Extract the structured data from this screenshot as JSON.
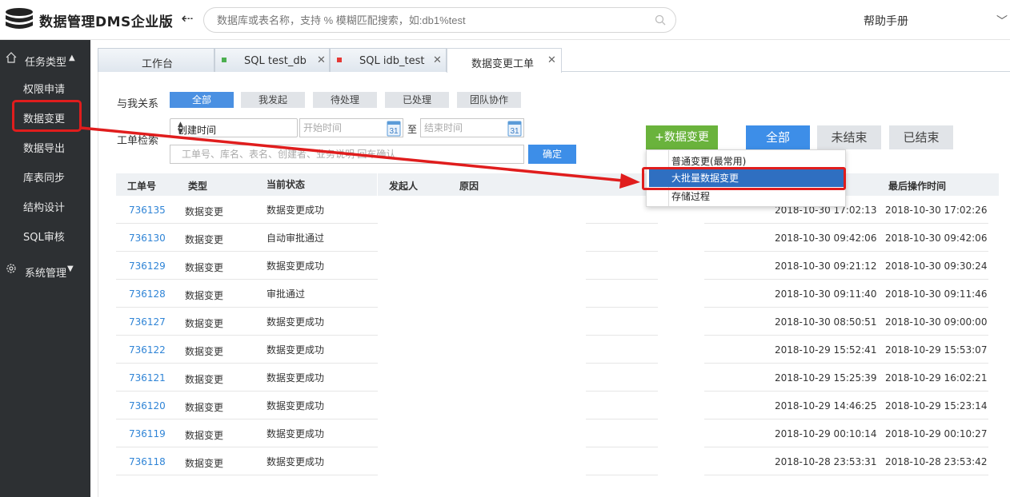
{
  "header": {
    "app_title": "数据管理DMS企业版",
    "search_placeholder": "数据库或表名称，支持 % 模糊匹配搜索，如:db1%test",
    "help": "帮助手册"
  },
  "sidebar": {
    "group_tasks": "任务类型",
    "items": [
      "权限申请",
      "数据变更",
      "数据导出",
      "库表同步",
      "结构设计",
      "SQL审核"
    ],
    "group_system": "系统管理"
  },
  "tabs": [
    {
      "label": "工作台"
    },
    {
      "label": "SQL test_db",
      "dot_color": "#4caf50"
    },
    {
      "label": "SQL idb_test",
      "dot_color": "#e53935"
    },
    {
      "label": "数据变更工单"
    }
  ],
  "filters": {
    "relation_label": "与我关系",
    "relation_options": [
      "全部",
      "我发起",
      "待处理",
      "已处理",
      "团队协作"
    ],
    "search_label": "工单检索",
    "time_select": "创建时间",
    "start_placeholder": "开始时间",
    "to": "至",
    "end_placeholder": "结束时间",
    "calendar_day": "31",
    "keyword_placeholder": "工单号、库名、表名、创建者、业务说明 回车确认",
    "confirm": "确定",
    "new_change": "+数据变更",
    "status_all": "全部",
    "status_open": "未结束",
    "status_closed": "已结束"
  },
  "dropdown": {
    "items": [
      "普通变更(最常用)",
      "大批量数据变更",
      "存储过程"
    ]
  },
  "table": {
    "headers": [
      "工单号",
      "类型",
      "当前状态",
      "发起人",
      "原因",
      "最后操作时间"
    ],
    "rows": [
      {
        "id": "736135",
        "type": "数据变更",
        "status": "数据变更成功",
        "created": "2018-10-30 17:02:13",
        "last": "2018-10-30 17:02:26"
      },
      {
        "id": "736130",
        "type": "数据变更",
        "status": "自动审批通过",
        "created": "2018-10-30 09:42:06",
        "last": "2018-10-30 09:42:06"
      },
      {
        "id": "736129",
        "type": "数据变更",
        "status": "数据变更成功",
        "created": "2018-10-30 09:21:12",
        "last": "2018-10-30 09:30:24"
      },
      {
        "id": "736128",
        "type": "数据变更",
        "status": "审批通过",
        "created": "2018-10-30 09:11:40",
        "last": "2018-10-30 09:11:46"
      },
      {
        "id": "736127",
        "type": "数据变更",
        "status": "数据变更成功",
        "created": "2018-10-30 08:50:51",
        "last": "2018-10-30 09:00:00"
      },
      {
        "id": "736122",
        "type": "数据变更",
        "status": "数据变更成功",
        "created": "2018-10-29 15:52:41",
        "last": "2018-10-29 15:53:07"
      },
      {
        "id": "736121",
        "type": "数据变更",
        "status": "数据变更成功",
        "created": "2018-10-29 15:25:39",
        "last": "2018-10-29 16:02:21"
      },
      {
        "id": "736120",
        "type": "数据变更",
        "status": "数据变更成功",
        "created": "2018-10-29 14:46:25",
        "last": "2018-10-29 15:23:14"
      },
      {
        "id": "736119",
        "type": "数据变更",
        "status": "数据变更成功",
        "created": "2018-10-29 00:10:14",
        "last": "2018-10-29 00:10:27"
      },
      {
        "id": "736118",
        "type": "数据变更",
        "status": "数据变更成功",
        "created": "2018-10-28 23:53:31",
        "last": "2018-10-28 23:53:42"
      }
    ]
  },
  "annotation": {
    "color": "#e01d1d"
  }
}
